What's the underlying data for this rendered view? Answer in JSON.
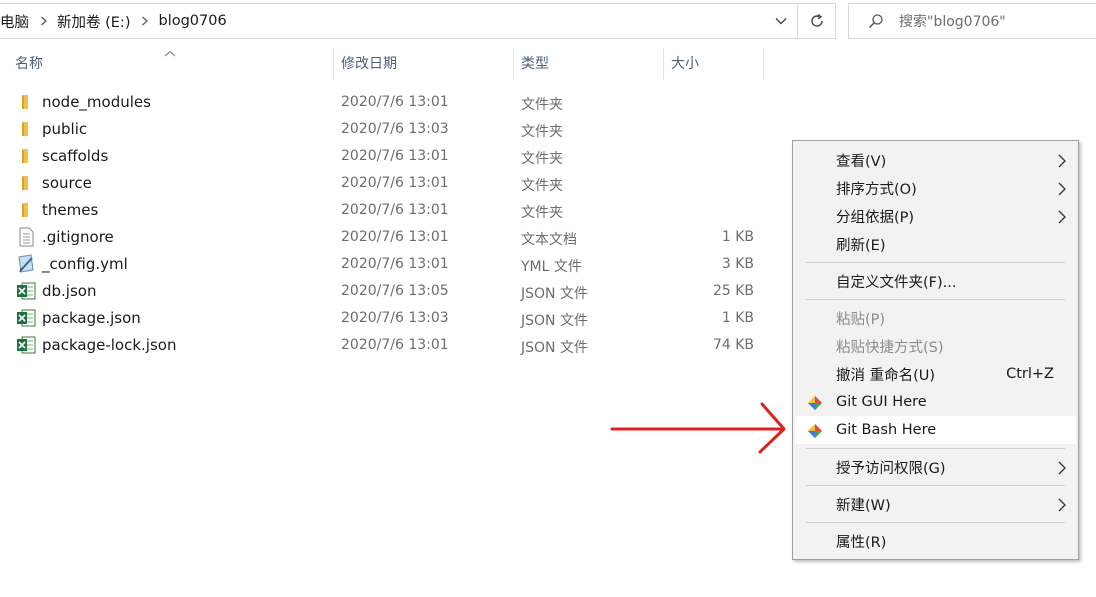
{
  "address": {
    "crumbs": [
      "电脑",
      "新加卷 (E:)",
      "blog0706"
    ]
  },
  "search": {
    "placeholder": "搜索\"blog0706\""
  },
  "columns": {
    "name": "名称",
    "date": "修改日期",
    "type": "类型",
    "size": "大小"
  },
  "files": [
    {
      "name": "node_modules",
      "date": "2020/7/6 13:01",
      "type": "文件夹",
      "size": "",
      "icon": "folder-icon"
    },
    {
      "name": "public",
      "date": "2020/7/6 13:03",
      "type": "文件夹",
      "size": "",
      "icon": "folder-icon"
    },
    {
      "name": "scaffolds",
      "date": "2020/7/6 13:01",
      "type": "文件夹",
      "size": "",
      "icon": "folder-icon"
    },
    {
      "name": "source",
      "date": "2020/7/6 13:01",
      "type": "文件夹",
      "size": "",
      "icon": "folder-icon"
    },
    {
      "name": "themes",
      "date": "2020/7/6 13:01",
      "type": "文件夹",
      "size": "",
      "icon": "folder-icon"
    },
    {
      "name": ".gitignore",
      "date": "2020/7/6 13:01",
      "type": "文本文档",
      "size": "1 KB",
      "icon": "text-file-icon"
    },
    {
      "name": "_config.yml",
      "date": "2020/7/6 13:01",
      "type": "YML 文件",
      "size": "3 KB",
      "icon": "yml-file-icon"
    },
    {
      "name": "db.json",
      "date": "2020/7/6 13:05",
      "type": "JSON 文件",
      "size": "25 KB",
      "icon": "excel-file-icon"
    },
    {
      "name": "package.json",
      "date": "2020/7/6 13:03",
      "type": "JSON 文件",
      "size": "1 KB",
      "icon": "excel-file-icon"
    },
    {
      "name": "package-lock.json",
      "date": "2020/7/6 13:01",
      "type": "JSON 文件",
      "size": "74 KB",
      "icon": "excel-file-icon"
    }
  ],
  "menu": {
    "view": "查看(V)",
    "sort": "排序方式(O)",
    "group": "分组依据(P)",
    "refresh": "刷新(E)",
    "customize": "自定义文件夹(F)...",
    "paste": "粘贴(P)",
    "paste_shortcut": "粘贴快捷方式(S)",
    "undo": "撤消 重命名(U)",
    "undo_shortcut": "Ctrl+Z",
    "git_gui": "Git GUI Here",
    "git_bash": "Git Bash Here",
    "grant_access": "授予访问权限(G)",
    "new": "新建(W)",
    "properties": "属性(R)"
  },
  "colors": {
    "folder": "#f3c14b",
    "annotation_arrow": "#e02020",
    "menu_bg": "#f2f2f2",
    "header_text": "#4c607a"
  }
}
